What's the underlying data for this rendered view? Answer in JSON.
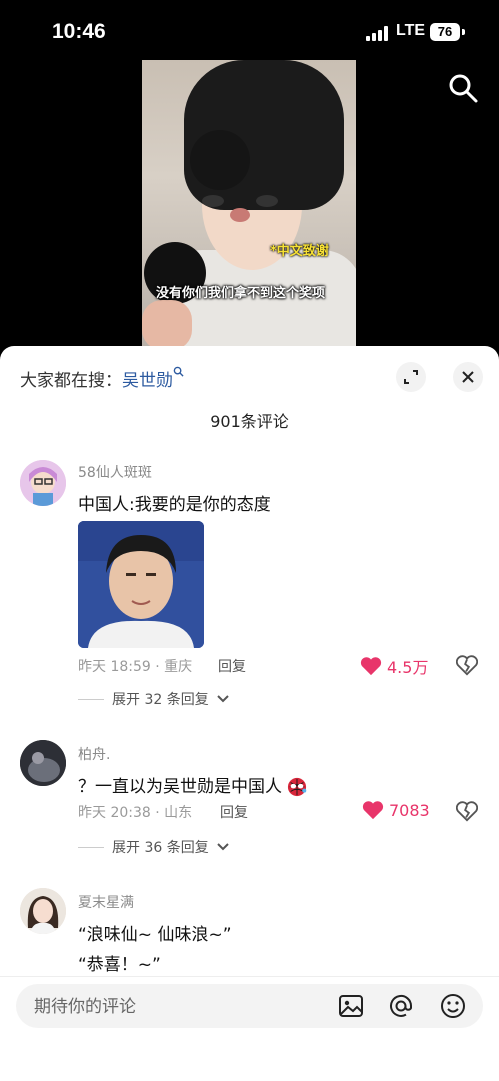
{
  "status": {
    "time": "10:46",
    "network": "LTE",
    "battery": "76"
  },
  "video": {
    "caption_tag": "*中文致谢",
    "caption_main": "没有你们我们拿不到这个奖项"
  },
  "sheet": {
    "hot_prefix": "大家都在搜：",
    "hot_keyword": "吴世勋",
    "comment_count": "901条评论",
    "comments": [
      {
        "username": "58仙人斑斑",
        "text": "中国人:我要的是你的态度",
        "meta": "昨天 18:59 · 重庆",
        "reply_label": "回复",
        "likes": "4.5万",
        "expand": "展开 32 条回复"
      },
      {
        "username": "柏舟.",
        "text": "？一直以为吴世勋是中国人",
        "meta": "昨天 20:38 · 山东",
        "reply_label": "回复",
        "likes": "7083",
        "expand": "展开 36 条回复"
      },
      {
        "username": "夏末星满",
        "text_line1": "“浪味仙~ 仙味浪~”",
        "text_line2": "“恭喜！~”"
      }
    ]
  },
  "composer": {
    "placeholder": "期待你的评论"
  },
  "colors": {
    "like": "#e8356a",
    "keyword": "#2c5aa0",
    "sheet_bg": "#ffffff"
  }
}
